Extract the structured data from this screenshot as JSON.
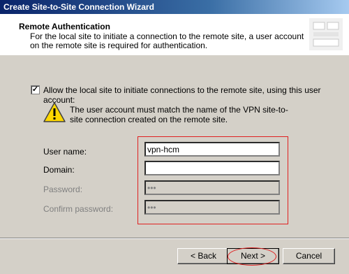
{
  "window": {
    "title": "Create Site-to-Site Connection Wizard"
  },
  "header": {
    "title": "Remote Authentication",
    "description": "For the local site to initiate a connection to the remote site, a user account on the remote site is required for authentication.",
    "graphic_icon": "wizard-graphic"
  },
  "options": {
    "allow_checkbox_label": "Allow the local site to initiate connections to the remote site, using this user account:",
    "allow_checked": true,
    "check_glyph": "✓"
  },
  "warning": {
    "icon": "warning-icon",
    "text": "The user account must match the name of the VPN site-to-site connection created on the remote site."
  },
  "fields": {
    "username_label": "User name:",
    "username_value": "vpn-hcm",
    "domain_label": "Domain:",
    "domain_value": "",
    "password_label": "Password:",
    "password_value": "•••",
    "confirm_label": "Confirm password:",
    "confirm_value": "•••"
  },
  "buttons": {
    "back": "< Back",
    "next": "Next >",
    "cancel": "Cancel"
  },
  "colors": {
    "titlebar_start": "#0a246a",
    "titlebar_end": "#a6caf0",
    "annotation": "#e02020"
  }
}
